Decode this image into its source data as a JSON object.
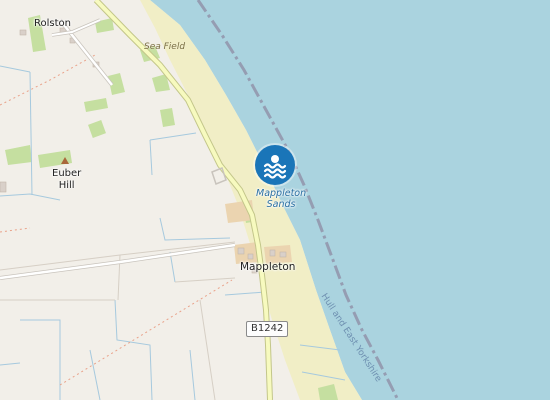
{
  "map": {
    "places": {
      "rolston": "Rolston",
      "euber_hill": "Euber\nHill",
      "mappleton": "Mappleton"
    },
    "features": {
      "sea_field": "Sea Field",
      "mappleton_sands": "Mappleton\nSands"
    },
    "roads": {
      "b1242": "B1242"
    },
    "boundary": {
      "label": "Hull and East Yorkshire"
    },
    "poi": {
      "icon": "beach-swimmer-icon"
    },
    "colors": {
      "sea": "#aad3df",
      "land": "#f2efe9",
      "beach": "#f1eec6",
      "grass": "#c5dfa0",
      "road_fill": "#f7fabf",
      "road_casing": "#c3c68a",
      "boundary_line": "#8e8ba3",
      "marker": "#1a75b8"
    }
  }
}
